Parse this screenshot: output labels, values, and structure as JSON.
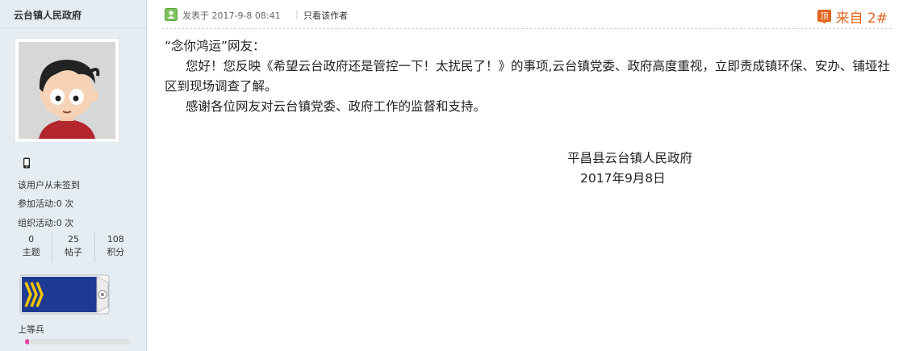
{
  "author": {
    "name": "云台镇人民政府",
    "sign_status": "该用户从未签到",
    "activities_joined": "参加活动:0 次",
    "activities_organized": "组织活动:0 次",
    "counts": [
      {
        "value": "0",
        "label": "主题"
      },
      {
        "value": "25",
        "label": "帖子"
      },
      {
        "value": "108",
        "label": "积分"
      }
    ],
    "rank": "上等兵",
    "rank_progress": 0.04
  },
  "post": {
    "posted_at": "发表于 2017-9-8 08:41",
    "separator": "|",
    "only_author": "只看该作者",
    "floor": "来自 2#",
    "top_icon_text": "顶",
    "greeting": "“念你鸿运”网友：",
    "paragraph1": "您好！您反映《希望云台政府还是管控一下！太扰民了！》的事项,云台镇党委、政府高度重视，立即责成镇环保、安办、铺垭社区到现场调查了解。",
    "paragraph2": "感谢各位网友对云台镇党委、政府工作的监督和支持。",
    "signature_name": "平昌县云台镇人民政府",
    "signature_date": "2017年9月8日"
  },
  "colors": {
    "sidebar_bg": "#e5edf2",
    "floor_accent": "#e2661f",
    "rank_progress": "#e63fa6"
  }
}
